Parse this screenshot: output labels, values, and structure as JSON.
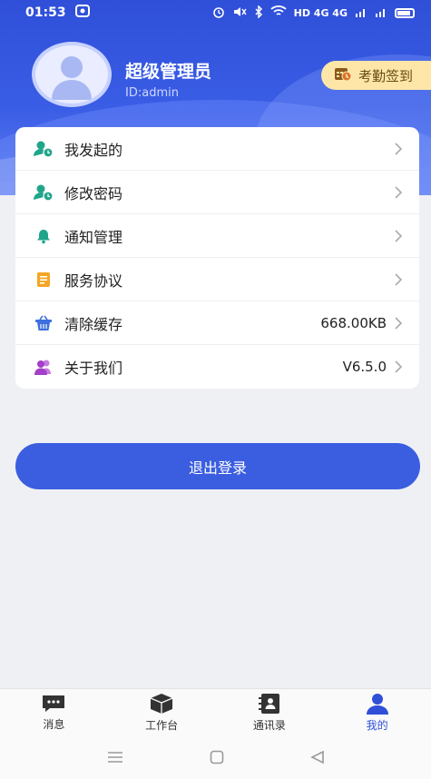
{
  "status_bar": {
    "time": "01:53",
    "indicators": "HD 4G 4G"
  },
  "profile": {
    "name": "超级管理员",
    "id_text": "ID:admin",
    "checkin_label": "考勤签到"
  },
  "menu": {
    "items": [
      {
        "label": "我发起的",
        "value": "",
        "icon": "user-clock-icon",
        "color": "#1fa58a"
      },
      {
        "label": "修改密码",
        "value": "",
        "icon": "user-lock-icon",
        "color": "#1fa58a"
      },
      {
        "label": "通知管理",
        "value": "",
        "icon": "bell-icon",
        "color": "#1fa58a"
      },
      {
        "label": "服务协议",
        "value": "",
        "icon": "document-icon",
        "color": "#f5a623"
      },
      {
        "label": "清除缓存",
        "value": "668.00KB",
        "icon": "basket-icon",
        "color": "#3d6fe0"
      },
      {
        "label": "关于我们",
        "value": "V6.5.0",
        "icon": "users-icon",
        "color": "#a33fc9"
      }
    ]
  },
  "logout_label": "退出登录",
  "tabs": [
    {
      "label": "消息",
      "icon": "message-icon",
      "active": false
    },
    {
      "label": "工作台",
      "icon": "cube-icon",
      "active": false
    },
    {
      "label": "通讯录",
      "icon": "contacts-icon",
      "active": false
    },
    {
      "label": "我的",
      "icon": "person-icon",
      "active": true
    }
  ],
  "colors": {
    "primary": "#3b5ee0",
    "checkin_bg": "#fde6a8",
    "page_bg": "#eff0f4"
  }
}
